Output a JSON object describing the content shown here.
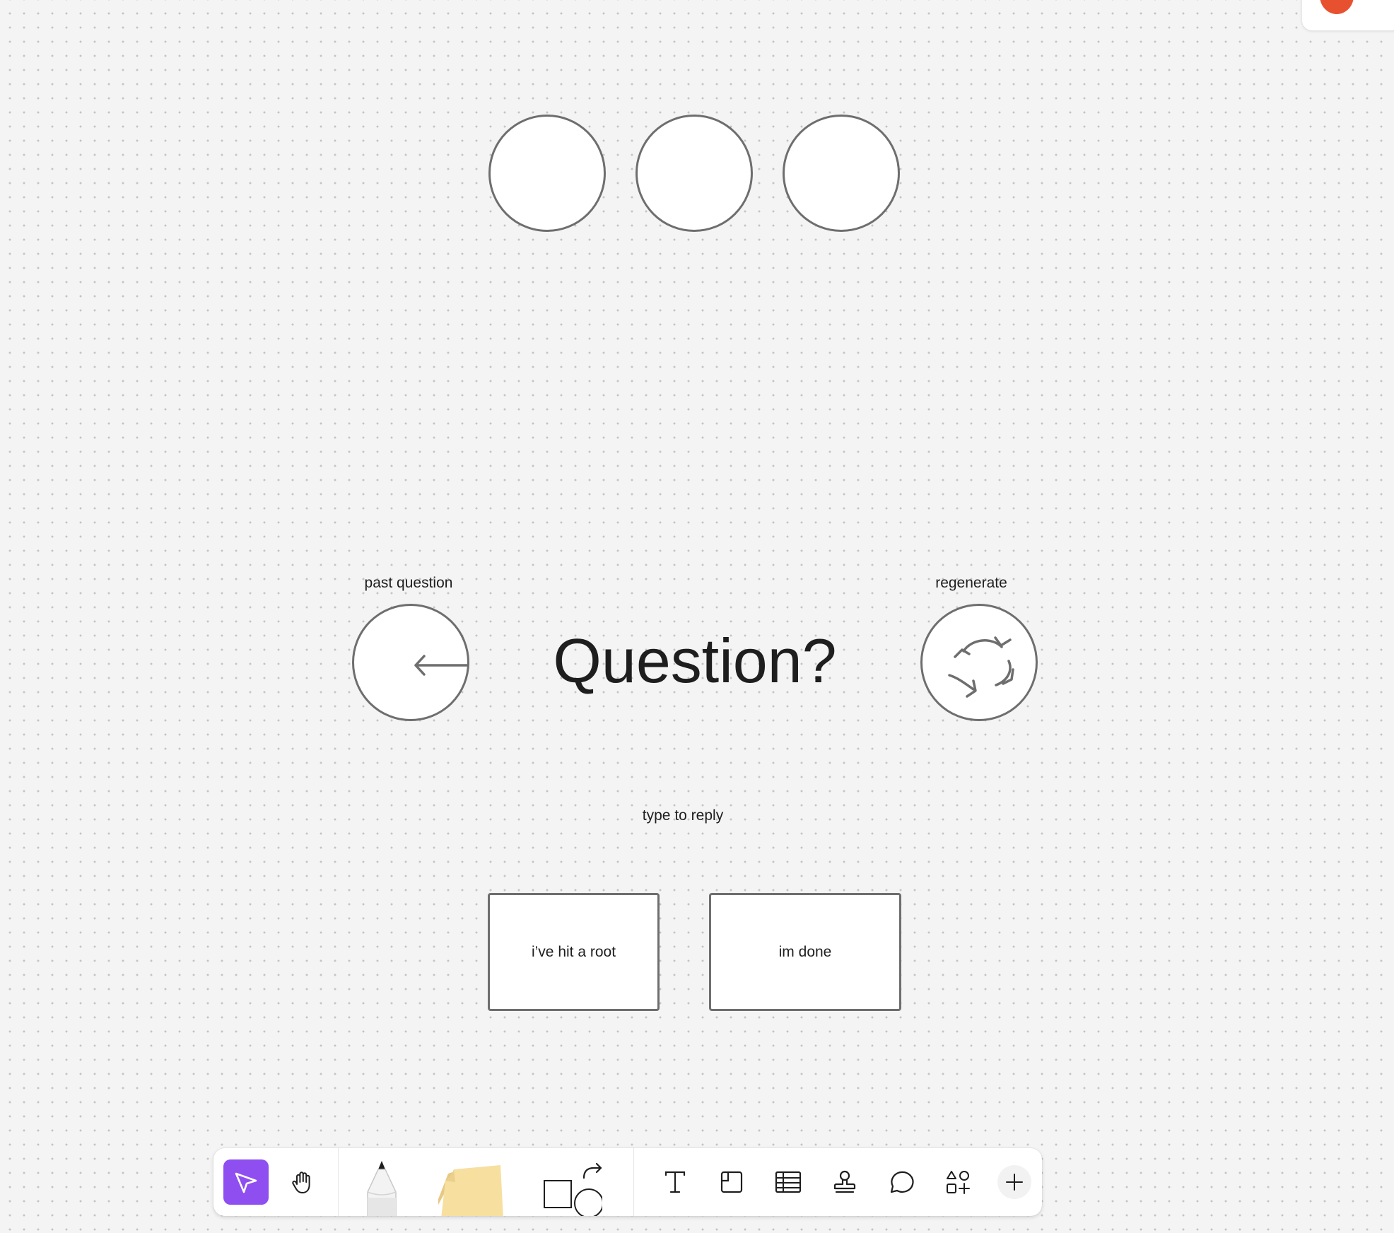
{
  "colors": {
    "accent": "#8f4ef0",
    "avatar": "#e8512f",
    "canvas": "#f4f4f4",
    "stroke": "#6e6e6e",
    "sticky_note": "#f7dfa0"
  },
  "canvas": {
    "past_question_label": "past question",
    "question": "Question?",
    "regenerate_label": "regenerate",
    "reply_label": "type to reply",
    "answers": [
      {
        "label": "i’ve hit a root"
      },
      {
        "label": "im done"
      }
    ],
    "progress_count": 3
  },
  "toolbar": {
    "tools": [
      {
        "icon": "cursor-icon",
        "active": true
      },
      {
        "icon": "hand-icon",
        "active": false
      },
      {
        "icon": "pen-icon",
        "active": false
      },
      {
        "icon": "sticky-note-icon",
        "active": false
      },
      {
        "icon": "shapes-icon",
        "active": false
      },
      {
        "icon": "text-icon",
        "active": false
      },
      {
        "icon": "section-icon",
        "active": false
      },
      {
        "icon": "table-icon",
        "active": false
      },
      {
        "icon": "stamp-icon",
        "active": false
      },
      {
        "icon": "comment-icon",
        "active": false
      },
      {
        "icon": "widgets-icon",
        "active": false
      },
      {
        "icon": "plus-icon",
        "active": false
      }
    ]
  }
}
